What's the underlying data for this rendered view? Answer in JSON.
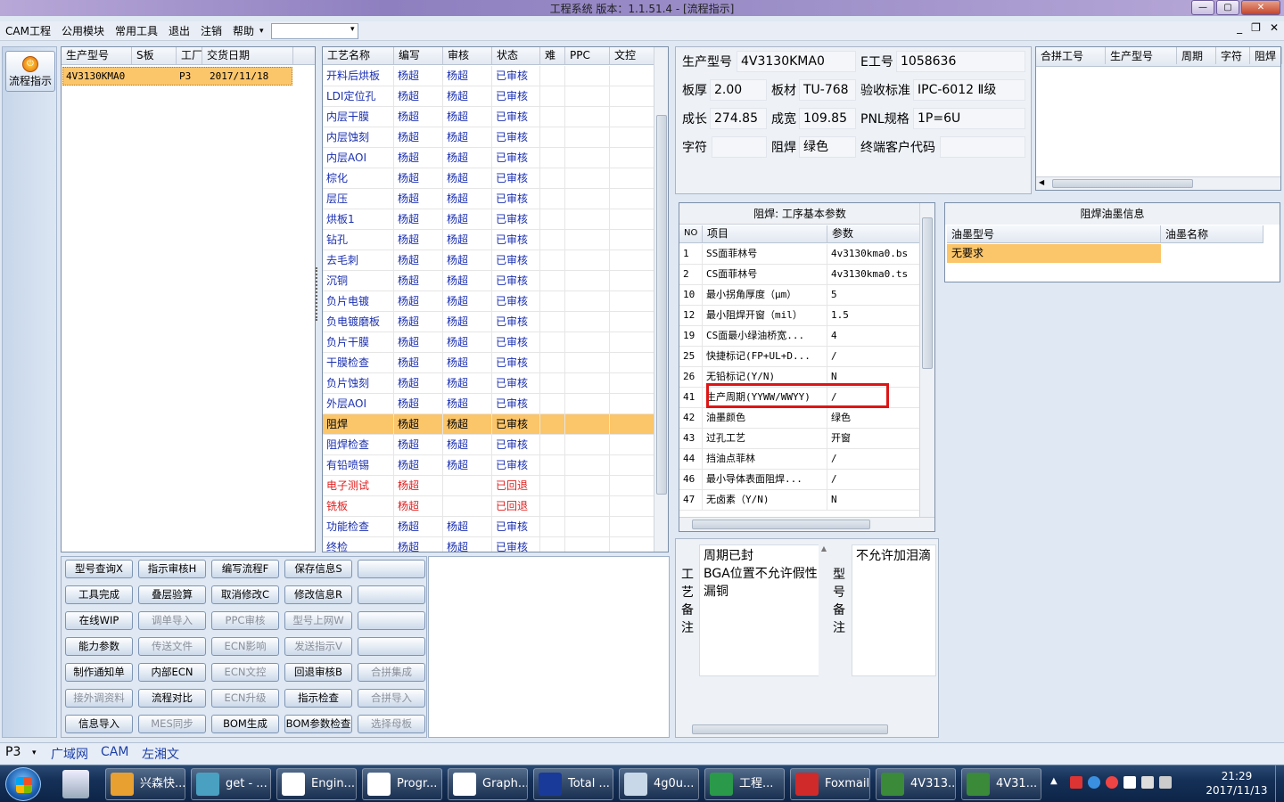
{
  "window": {
    "title": "工程系统   版本：1.1.51.4 - [流程指示]",
    "btn_min": "—",
    "btn_max": "▢",
    "btn_close": "✕"
  },
  "menu": [
    "CAM工程",
    "公用模块",
    "常用工具",
    "退出",
    "注销",
    "帮助"
  ],
  "mdi": {
    "min": "_",
    "restore": "❐",
    "close": "✕"
  },
  "flow_button": "流程指示",
  "model_table": {
    "headers": [
      "生产型号",
      "S板",
      "工厂",
      "交货日期"
    ],
    "row": [
      "4V3130KMA0",
      "",
      "P3",
      "2017/11/18"
    ]
  },
  "process": {
    "headers": [
      "工艺名称",
      "编写",
      "审核",
      "状态",
      "难",
      "PPC",
      "文控"
    ],
    "rows": [
      [
        "开料后烘板",
        "杨超",
        "杨超",
        "已审核"
      ],
      [
        "LDI定位孔",
        "杨超",
        "杨超",
        "已审核"
      ],
      [
        "内层干膜",
        "杨超",
        "杨超",
        "已审核"
      ],
      [
        "内层蚀刻",
        "杨超",
        "杨超",
        "已审核"
      ],
      [
        "内层AOI",
        "杨超",
        "杨超",
        "已审核"
      ],
      [
        "棕化",
        "杨超",
        "杨超",
        "已审核"
      ],
      [
        "层压",
        "杨超",
        "杨超",
        "已审核"
      ],
      [
        "烘板1",
        "杨超",
        "杨超",
        "已审核"
      ],
      [
        "钻孔",
        "杨超",
        "杨超",
        "已审核"
      ],
      [
        "去毛刺",
        "杨超",
        "杨超",
        "已审核"
      ],
      [
        "沉铜",
        "杨超",
        "杨超",
        "已审核"
      ],
      [
        "负片电镀",
        "杨超",
        "杨超",
        "已审核"
      ],
      [
        "负电镀磨板",
        "杨超",
        "杨超",
        "已审核"
      ],
      [
        "负片干膜",
        "杨超",
        "杨超",
        "已审核"
      ],
      [
        "干膜检查",
        "杨超",
        "杨超",
        "已审核"
      ],
      [
        "负片蚀刻",
        "杨超",
        "杨超",
        "已审核"
      ],
      [
        "外层AOI",
        "杨超",
        "杨超",
        "已审核"
      ],
      [
        "阻焊",
        "杨超",
        "杨超",
        "已审核"
      ],
      [
        "阻焊检查",
        "杨超",
        "杨超",
        "已审核"
      ],
      [
        "有铅喷锡",
        "杨超",
        "杨超",
        "已审核"
      ],
      [
        "电子测试",
        "杨超",
        "",
        "已回退"
      ],
      [
        "铣板",
        "杨超",
        "",
        "已回退"
      ],
      [
        "功能检查",
        "杨超",
        "杨超",
        "已审核"
      ],
      [
        "终检",
        "杨超",
        "杨超",
        "已审核"
      ]
    ]
  },
  "buttons": [
    [
      "型号查询X",
      "指示审核H",
      "编写流程F",
      "保存信息S",
      ""
    ],
    [
      "工具完成",
      "叠层验算",
      "取消修改C",
      "修改信息R",
      ""
    ],
    [
      "在线WIP",
      "调单导入",
      "PPC审核",
      "型号上网W",
      ""
    ],
    [
      "能力参数",
      "传送文件",
      "ECN影响",
      "发送指示V",
      ""
    ],
    [
      "制作通知单",
      "内部ECN",
      "ECN文控",
      "回退审核B",
      "合拼集成"
    ],
    [
      "接外调资料",
      "流程对比",
      "ECN升级",
      "指示检查",
      "合拼导入"
    ],
    [
      "信息导入",
      "MES同步",
      "BOM生成",
      "BOM参数检查",
      "选择母板"
    ]
  ],
  "info": {
    "l_model": "生产型号",
    "model": "4V3130KMA0",
    "l_eno": "E工号",
    "eno": "1058636",
    "l_thick": "板厚",
    "thick": "2.00",
    "l_mat": "板材",
    "mat": "TU-768",
    "l_std": "验收标准",
    "std": "IPC-6012 Ⅱ级",
    "l_len": "成长",
    "len": "274.85",
    "l_wid": "成宽",
    "wid": "109.85",
    "l_pnl": "PNL规格",
    "pnl": "1P=6U",
    "l_char": "字符",
    "char": "",
    "l_mask": "阻焊",
    "mask": "绿色",
    "l_cust": "终端客户代码",
    "cust": ""
  },
  "merge_headers": [
    "合拼工号",
    "生产型号",
    "周期",
    "字符",
    "阻焊"
  ],
  "params": {
    "title": "阻焊: 工序基本参数",
    "headers": [
      "NO",
      "项目",
      "参数"
    ],
    "rows": [
      [
        "1",
        "SS面菲林号",
        "4v3130kma0.bs"
      ],
      [
        "2",
        "CS面菲林号",
        "4v3130kma0.ts"
      ],
      [
        "10",
        "最小拐角厚度（μm）",
        "5"
      ],
      [
        "12",
        "最小阻焊开窗（mil）",
        "1.5"
      ],
      [
        "19",
        "CS面最小绿油桥宽...",
        "4"
      ],
      [
        "25",
        "快捷标记(FP+UL+D...",
        "/"
      ],
      [
        "26",
        "无铅标记(Y/N)",
        "N"
      ],
      [
        "41",
        "生产周期(YYWW/WWYY)",
        "/"
      ],
      [
        "42",
        "油墨颜色",
        "绿色"
      ],
      [
        "43",
        "过孔工艺",
        "开窗"
      ],
      [
        "44",
        "挡油点菲林",
        "/"
      ],
      [
        "46",
        "最小导体表面阻焊...",
        "/"
      ],
      [
        "47",
        "无卤素（Y/N)",
        "N"
      ]
    ]
  },
  "oil": {
    "title": "阻焊油墨信息",
    "headers": [
      "油墨型号",
      "油墨名称"
    ],
    "row": [
      "无要求",
      ""
    ]
  },
  "remarks": {
    "process_label": "工艺备注",
    "process_text": "周期已封\nBGA位置不允许假性漏铜",
    "model_label": "型号备注",
    "model_text": "不允许加泪滴"
  },
  "status": {
    "combo": "P3",
    "items": [
      "广域网",
      "CAM",
      "左湘文"
    ]
  },
  "taskbar": {
    "items": [
      "兴森快...",
      "get - ...",
      "Engin...",
      "Progr...",
      "Graph...",
      "Total ...",
      "4g0u...",
      "工程...",
      "Foxmail",
      "4V313...",
      "4V31..."
    ],
    "time": "21:29",
    "date": "2017/11/13"
  }
}
